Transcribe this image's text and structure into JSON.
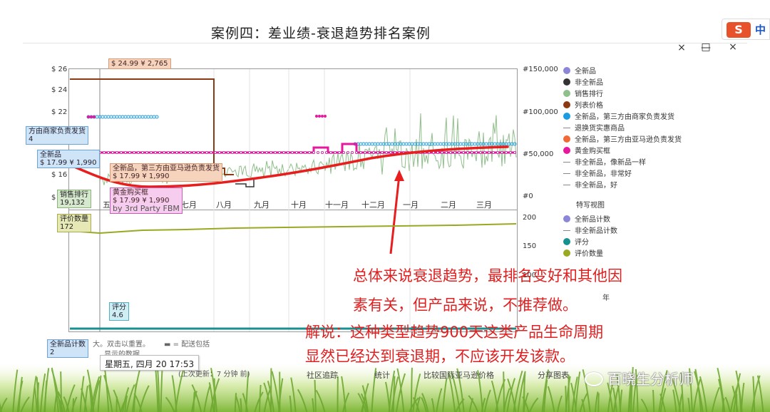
{
  "slide": {
    "title": "案例四：差业绩-衰退趋势排名案例"
  },
  "ime": {
    "badge": "S",
    "label": "中"
  },
  "window": {
    "controls": [
      "×",
      "□",
      "—",
      "×"
    ]
  },
  "chart": {
    "price_axis": [
      "$ 26",
      "$ 24",
      "$ 22",
      "$ 16",
      "$"
    ],
    "rank_axis": [
      "#150,000",
      "#100,000",
      "#50,000",
      "#0"
    ],
    "count_axis": [
      "200",
      "150",
      "100"
    ],
    "months": [
      "五",
      "七月",
      "八月",
      "九月",
      "十月",
      "十一月",
      "十二月",
      "一月",
      "二月",
      "三月"
    ]
  },
  "tooltips": {
    "list_price": "$ 24.99  ¥ 2,765",
    "third_party_merchant": "方由商家负责发货",
    "third_party_merchant_value": "4",
    "new_label": "全新品",
    "new_value": "$ 17.99  ¥ 1,990",
    "amazon_fulfilled_label": "全新品，第三方由亚马逊负责发货",
    "amazon_fulfilled_value": "$ 17.99  ¥ 1,990",
    "buybox_label": "黄金购买框",
    "buybox_value": "$ 17.99  ¥ 1,990",
    "buybox_seller": "by 3rd Party FBM",
    "sales_rank_label": "销售排行",
    "sales_rank_value": "19,132",
    "review_count_label": "评价数量",
    "review_count_value": "172",
    "rating_label": "评分",
    "rating_value": "4.6",
    "new_count_label": "全新品计数",
    "new_count_value": "2"
  },
  "legend_top": [
    {
      "label": "全新品",
      "color": "#8b86d8",
      "kind": "dot"
    },
    {
      "label": "非全新品",
      "color": "#333333",
      "kind": "dot"
    },
    {
      "label": "销售排行",
      "color": "#8fbf8a",
      "kind": "dot"
    },
    {
      "label": "列表价格",
      "color": "#8b3a12",
      "kind": "dot"
    },
    {
      "label": "全新品，第三方由商家负责发货",
      "color": "#1a9ce0",
      "kind": "dot"
    },
    {
      "label": "退换货实惠商品",
      "color": "#999999",
      "kind": "dash"
    },
    {
      "label": "全新品，第三方由亚马逊负责发货",
      "color": "#f06a35",
      "kind": "dot"
    },
    {
      "label": "黄金购买框",
      "color": "#e6189e",
      "kind": "dot"
    },
    {
      "label": "非全新品，像新品一样",
      "color": "#999999",
      "kind": "dash"
    },
    {
      "label": "非全新品，非常好",
      "color": "#999999",
      "kind": "dash"
    },
    {
      "label": "非全新品，好",
      "color": "#999999",
      "kind": "dash"
    }
  ],
  "legend_special": "特写视图",
  "legend_bottom": [
    {
      "label": "全新品计数",
      "color": "#8b86d8",
      "kind": "dot"
    },
    {
      "label": "非全新品计数",
      "color": "#999999",
      "kind": "dash"
    },
    {
      "label": "评分",
      "color": "#17918f",
      "kind": "dot"
    },
    {
      "label": "评价数量",
      "color": "#9aa822",
      "kind": "dot"
    }
  ],
  "annotation": {
    "line1": "总体来说衰退趋势，最排名变好和其他因",
    "line2": "素有关，但产品来说，不推荐做。",
    "line3": "解说：这种类型趋势900天这类产品生命周期",
    "line4": "显然已经达到衰退期，不应该开发该款。"
  },
  "footer": {
    "hint": "大。双击以重置。",
    "filter": "配送包括",
    "hint2": "显示的数据",
    "updated": "(上次更新：7 分钟 前)",
    "tabs": [
      "社区追踪",
      "统计",
      "比较国际亚马逊价格",
      "分享图表"
    ],
    "date": "星期五, 四月 20 17:53",
    "year_fragment": "年"
  },
  "watermark": "百晓生分析师",
  "colors": {
    "rank_line": "#8fbf8a",
    "trend": "#e81e1e",
    "buybox": "#e6189e",
    "merchant": "#1a9ce0",
    "list_price": "#8b3a12",
    "reviews": "#9aa822",
    "rating": "#17918f"
  }
}
